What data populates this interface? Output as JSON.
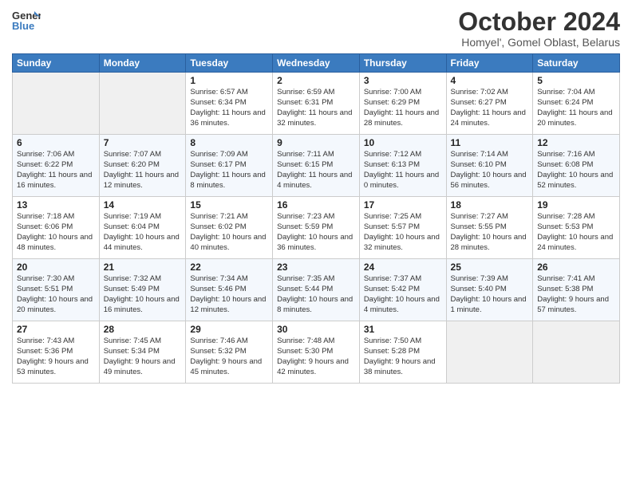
{
  "header": {
    "logo_line1": "General",
    "logo_line2": "Blue",
    "month": "October 2024",
    "location": "Homyel', Gomel Oblast, Belarus"
  },
  "days_of_week": [
    "Sunday",
    "Monday",
    "Tuesday",
    "Wednesday",
    "Thursday",
    "Friday",
    "Saturday"
  ],
  "weeks": [
    [
      {
        "day": "",
        "sunrise": "",
        "sunset": "",
        "daylight": ""
      },
      {
        "day": "",
        "sunrise": "",
        "sunset": "",
        "daylight": ""
      },
      {
        "day": "1",
        "sunrise": "Sunrise: 6:57 AM",
        "sunset": "Sunset: 6:34 PM",
        "daylight": "Daylight: 11 hours and 36 minutes."
      },
      {
        "day": "2",
        "sunrise": "Sunrise: 6:59 AM",
        "sunset": "Sunset: 6:31 PM",
        "daylight": "Daylight: 11 hours and 32 minutes."
      },
      {
        "day": "3",
        "sunrise": "Sunrise: 7:00 AM",
        "sunset": "Sunset: 6:29 PM",
        "daylight": "Daylight: 11 hours and 28 minutes."
      },
      {
        "day": "4",
        "sunrise": "Sunrise: 7:02 AM",
        "sunset": "Sunset: 6:27 PM",
        "daylight": "Daylight: 11 hours and 24 minutes."
      },
      {
        "day": "5",
        "sunrise": "Sunrise: 7:04 AM",
        "sunset": "Sunset: 6:24 PM",
        "daylight": "Daylight: 11 hours and 20 minutes."
      }
    ],
    [
      {
        "day": "6",
        "sunrise": "Sunrise: 7:06 AM",
        "sunset": "Sunset: 6:22 PM",
        "daylight": "Daylight: 11 hours and 16 minutes."
      },
      {
        "day": "7",
        "sunrise": "Sunrise: 7:07 AM",
        "sunset": "Sunset: 6:20 PM",
        "daylight": "Daylight: 11 hours and 12 minutes."
      },
      {
        "day": "8",
        "sunrise": "Sunrise: 7:09 AM",
        "sunset": "Sunset: 6:17 PM",
        "daylight": "Daylight: 11 hours and 8 minutes."
      },
      {
        "day": "9",
        "sunrise": "Sunrise: 7:11 AM",
        "sunset": "Sunset: 6:15 PM",
        "daylight": "Daylight: 11 hours and 4 minutes."
      },
      {
        "day": "10",
        "sunrise": "Sunrise: 7:12 AM",
        "sunset": "Sunset: 6:13 PM",
        "daylight": "Daylight: 11 hours and 0 minutes."
      },
      {
        "day": "11",
        "sunrise": "Sunrise: 7:14 AM",
        "sunset": "Sunset: 6:10 PM",
        "daylight": "Daylight: 10 hours and 56 minutes."
      },
      {
        "day": "12",
        "sunrise": "Sunrise: 7:16 AM",
        "sunset": "Sunset: 6:08 PM",
        "daylight": "Daylight: 10 hours and 52 minutes."
      }
    ],
    [
      {
        "day": "13",
        "sunrise": "Sunrise: 7:18 AM",
        "sunset": "Sunset: 6:06 PM",
        "daylight": "Daylight: 10 hours and 48 minutes."
      },
      {
        "day": "14",
        "sunrise": "Sunrise: 7:19 AM",
        "sunset": "Sunset: 6:04 PM",
        "daylight": "Daylight: 10 hours and 44 minutes."
      },
      {
        "day": "15",
        "sunrise": "Sunrise: 7:21 AM",
        "sunset": "Sunset: 6:02 PM",
        "daylight": "Daylight: 10 hours and 40 minutes."
      },
      {
        "day": "16",
        "sunrise": "Sunrise: 7:23 AM",
        "sunset": "Sunset: 5:59 PM",
        "daylight": "Daylight: 10 hours and 36 minutes."
      },
      {
        "day": "17",
        "sunrise": "Sunrise: 7:25 AM",
        "sunset": "Sunset: 5:57 PM",
        "daylight": "Daylight: 10 hours and 32 minutes."
      },
      {
        "day": "18",
        "sunrise": "Sunrise: 7:27 AM",
        "sunset": "Sunset: 5:55 PM",
        "daylight": "Daylight: 10 hours and 28 minutes."
      },
      {
        "day": "19",
        "sunrise": "Sunrise: 7:28 AM",
        "sunset": "Sunset: 5:53 PM",
        "daylight": "Daylight: 10 hours and 24 minutes."
      }
    ],
    [
      {
        "day": "20",
        "sunrise": "Sunrise: 7:30 AM",
        "sunset": "Sunset: 5:51 PM",
        "daylight": "Daylight: 10 hours and 20 minutes."
      },
      {
        "day": "21",
        "sunrise": "Sunrise: 7:32 AM",
        "sunset": "Sunset: 5:49 PM",
        "daylight": "Daylight: 10 hours and 16 minutes."
      },
      {
        "day": "22",
        "sunrise": "Sunrise: 7:34 AM",
        "sunset": "Sunset: 5:46 PM",
        "daylight": "Daylight: 10 hours and 12 minutes."
      },
      {
        "day": "23",
        "sunrise": "Sunrise: 7:35 AM",
        "sunset": "Sunset: 5:44 PM",
        "daylight": "Daylight: 10 hours and 8 minutes."
      },
      {
        "day": "24",
        "sunrise": "Sunrise: 7:37 AM",
        "sunset": "Sunset: 5:42 PM",
        "daylight": "Daylight: 10 hours and 4 minutes."
      },
      {
        "day": "25",
        "sunrise": "Sunrise: 7:39 AM",
        "sunset": "Sunset: 5:40 PM",
        "daylight": "Daylight: 10 hours and 1 minute."
      },
      {
        "day": "26",
        "sunrise": "Sunrise: 7:41 AM",
        "sunset": "Sunset: 5:38 PM",
        "daylight": "Daylight: 9 hours and 57 minutes."
      }
    ],
    [
      {
        "day": "27",
        "sunrise": "Sunrise: 7:43 AM",
        "sunset": "Sunset: 5:36 PM",
        "daylight": "Daylight: 9 hours and 53 minutes."
      },
      {
        "day": "28",
        "sunrise": "Sunrise: 7:45 AM",
        "sunset": "Sunset: 5:34 PM",
        "daylight": "Daylight: 9 hours and 49 minutes."
      },
      {
        "day": "29",
        "sunrise": "Sunrise: 7:46 AM",
        "sunset": "Sunset: 5:32 PM",
        "daylight": "Daylight: 9 hours and 45 minutes."
      },
      {
        "day": "30",
        "sunrise": "Sunrise: 7:48 AM",
        "sunset": "Sunset: 5:30 PM",
        "daylight": "Daylight: 9 hours and 42 minutes."
      },
      {
        "day": "31",
        "sunrise": "Sunrise: 7:50 AM",
        "sunset": "Sunset: 5:28 PM",
        "daylight": "Daylight: 9 hours and 38 minutes."
      },
      {
        "day": "",
        "sunrise": "",
        "sunset": "",
        "daylight": ""
      },
      {
        "day": "",
        "sunrise": "",
        "sunset": "",
        "daylight": ""
      }
    ]
  ]
}
